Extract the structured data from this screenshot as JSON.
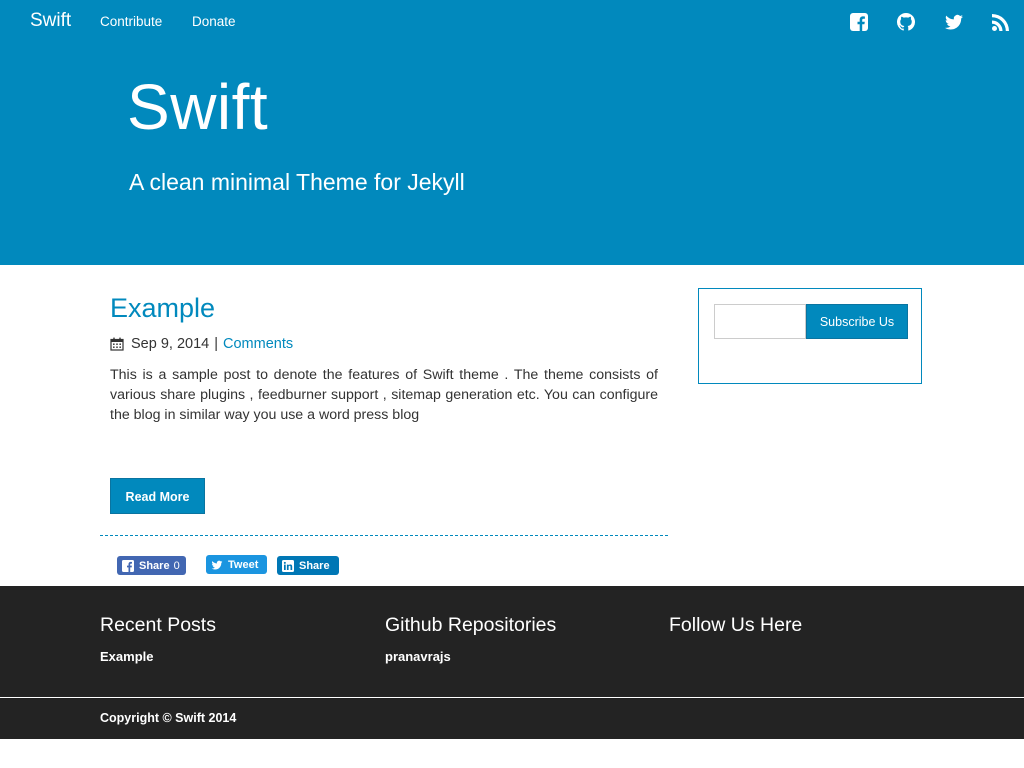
{
  "nav": {
    "brand": "Swift",
    "links": [
      "Contribute",
      "Donate"
    ],
    "social_icons": [
      "facebook-icon",
      "github-icon",
      "twitter-icon",
      "rss-icon"
    ]
  },
  "hero": {
    "title": "Swift",
    "subtitle": "A clean minimal Theme for Jekyll"
  },
  "post": {
    "title": "Example",
    "date": "Sep 9, 2014",
    "separator": "|",
    "comments_label": "Comments",
    "excerpt": "This is a sample post to denote the features of Swift theme . The theme consists of various share plugins , feedburner support , sitemap generation etc. You can configure the blog in similar way you use a word press blog",
    "read_more_label": "Read More"
  },
  "share": {
    "facebook_label": "Share",
    "facebook_count": "0",
    "twitter_label": "Tweet",
    "linkedin_label": "Share"
  },
  "sidebar": {
    "subscribe_placeholder": "",
    "subscribe_label": "Subscribe Us"
  },
  "footer": {
    "recent_posts_heading": "Recent Posts",
    "recent_posts": [
      "Example"
    ],
    "github_heading": "Github Repositories",
    "github_repos": [
      "pranavrajs"
    ],
    "follow_heading": "Follow Us Here",
    "copyright": "Copyright © Swift 2014"
  },
  "colors": {
    "primary": "#0189bd",
    "footer_bg": "#232323",
    "text": "#333333"
  }
}
